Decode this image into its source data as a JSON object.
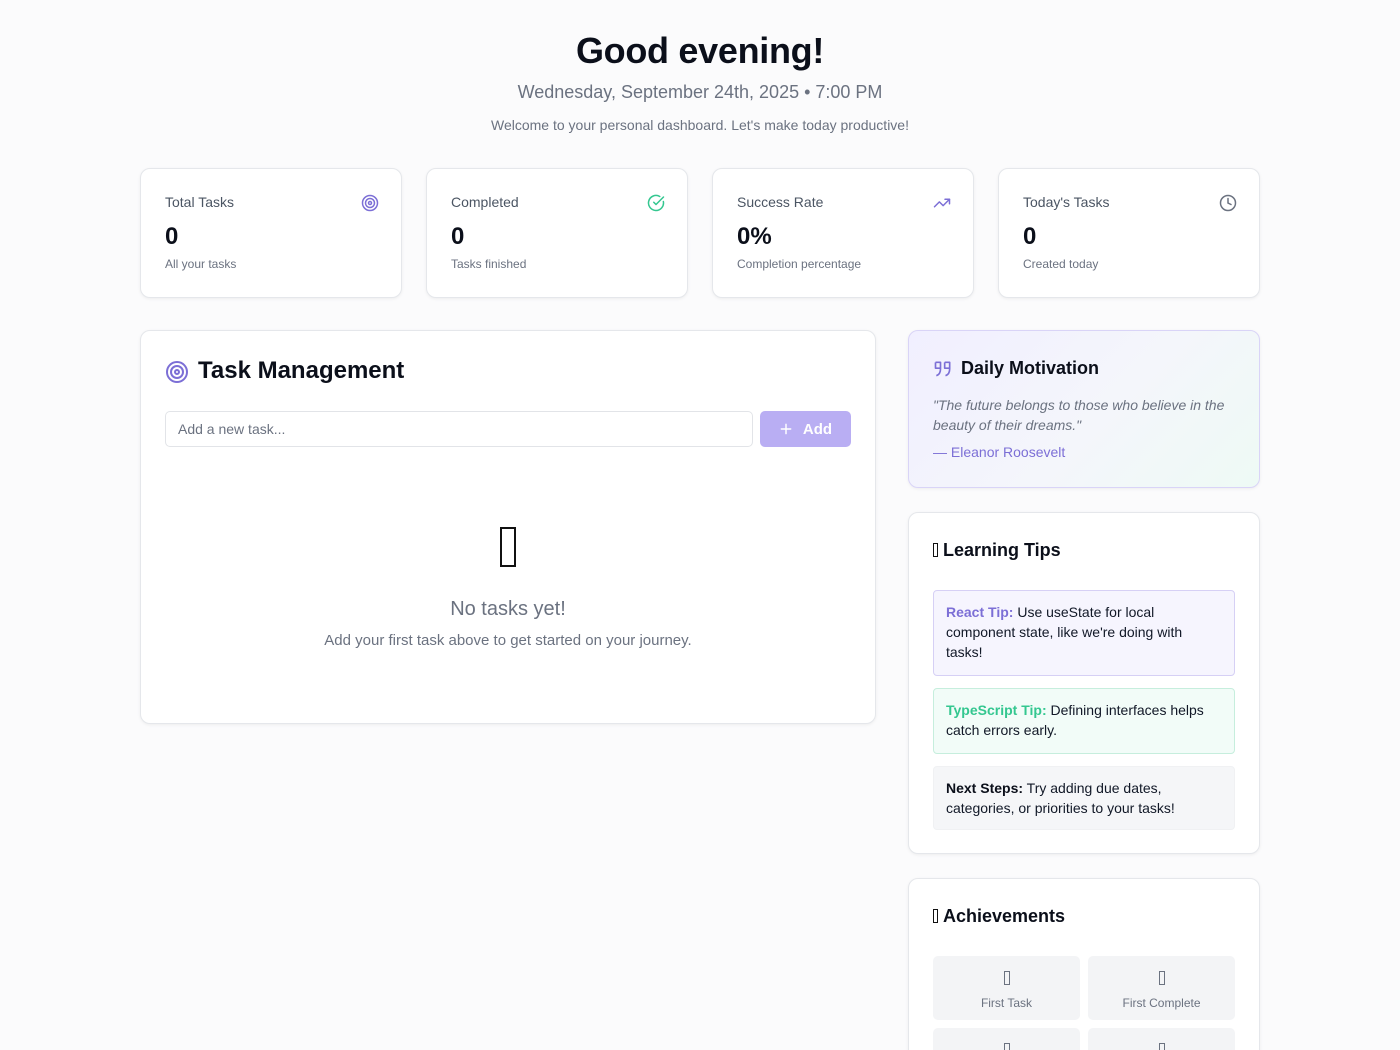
{
  "header": {
    "greeting": "Good evening! ",
    "datetime": "Wednesday, September 24th, 2025 • 7:00 PM",
    "welcome": "Welcome to your personal dashboard. Let's make today productive!"
  },
  "stats": [
    {
      "label": "Total Tasks",
      "value": "0",
      "sub": "All your tasks",
      "icon": "target-icon",
      "icon_color": "#7c6fd6"
    },
    {
      "label": "Completed",
      "value": "0",
      "sub": "Tasks finished",
      "icon": "check-circle-icon",
      "icon_color": "#34c790"
    },
    {
      "label": "Success Rate",
      "value": "0%",
      "sub": "Completion percentage",
      "icon": "trending-up-icon",
      "icon_color": "#7c6fd6"
    },
    {
      "label": "Today's Tasks",
      "value": "0",
      "sub": "Created today",
      "icon": "clock-icon",
      "icon_color": "#6b7280"
    }
  ],
  "tasks": {
    "title": "Task Management",
    "input_placeholder": "Add a new task...",
    "add_label": "Add",
    "empty_title": "No tasks yet!",
    "empty_sub": "Add your first task above to get started on your journey."
  },
  "motivation": {
    "title": "Daily Motivation",
    "quote": "\"The future belongs to those who believe in the beauty of their dreams.\"",
    "author": "— Eleanor Roosevelt"
  },
  "tips": {
    "title": "Learning Tips",
    "react_label": "React Tip:",
    "react_text": " Use useState for local component state, like we're doing with tasks!",
    "ts_label": "TypeScript Tip:",
    "ts_text": " Defining interfaces helps catch errors early.",
    "next_label": "Next Steps:",
    "next_text": " Try adding due dates, categories, or priorities to your tasks!"
  },
  "achievements": {
    "title": "Achievements",
    "items": [
      "First Task",
      "First Complete"
    ]
  },
  "colors": {
    "accent": "#7c6fd6",
    "success": "#34c790",
    "button_disabled": "#b9aef3"
  }
}
